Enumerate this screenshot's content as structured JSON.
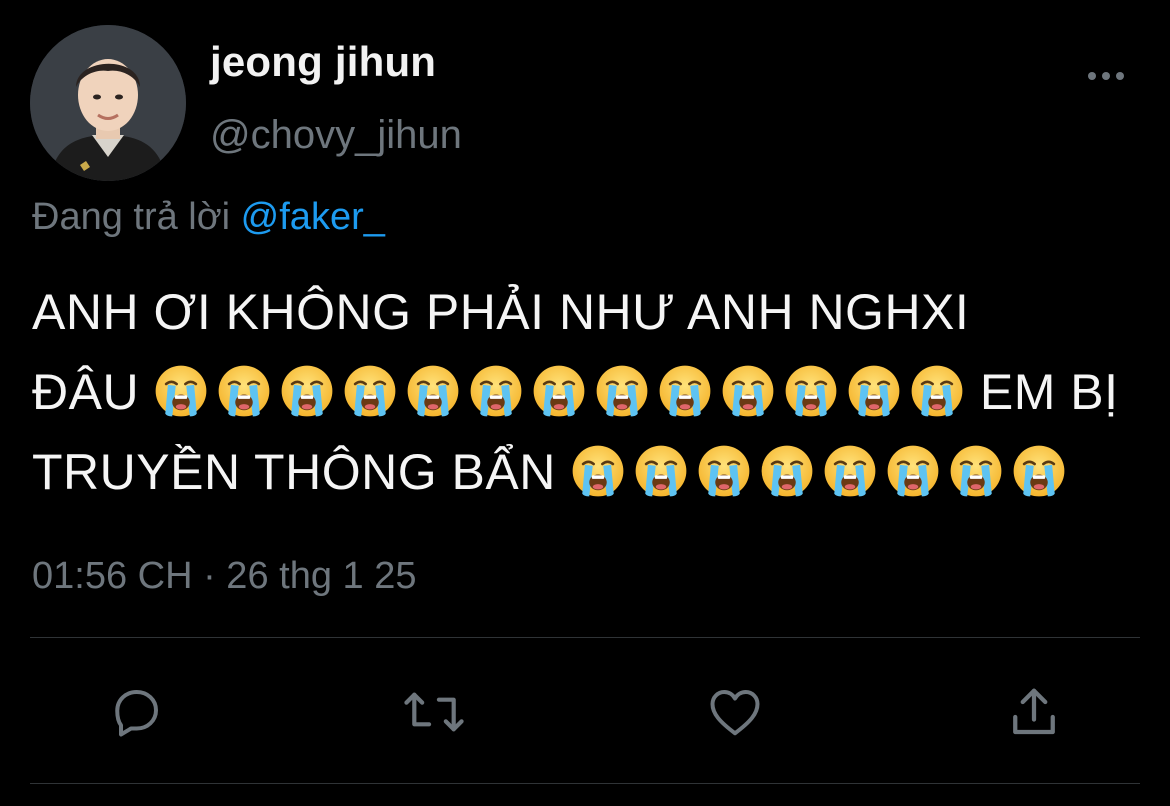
{
  "user": {
    "display_name": "jeong jihun",
    "handle": "@chovy_jihun"
  },
  "reply": {
    "prefix": "Đang trả lời",
    "mention": "@faker_"
  },
  "tweet": {
    "line1": "ANH ƠI KHÔNG PHẢI NHƯ ANH NGHXI",
    "line2_start": "ĐÂU",
    "line2_end": "EM BỊ",
    "line3_start": "TRUYỀN THÔNG BẨN",
    "emoji_name": "loudly-crying-face",
    "emoji_count_line2": 13,
    "emoji_count_line3": 8
  },
  "meta": {
    "timestamp": "01:56 CH · 26 thg 1 25"
  },
  "actions": [
    "reply-icon",
    "retweet-icon",
    "like-icon",
    "share-icon"
  ],
  "colors": {
    "background": "#000000",
    "text": "#f5f5f5",
    "muted": "#6e767d",
    "accent": "#1d9bf0",
    "divider": "#2f3336"
  }
}
